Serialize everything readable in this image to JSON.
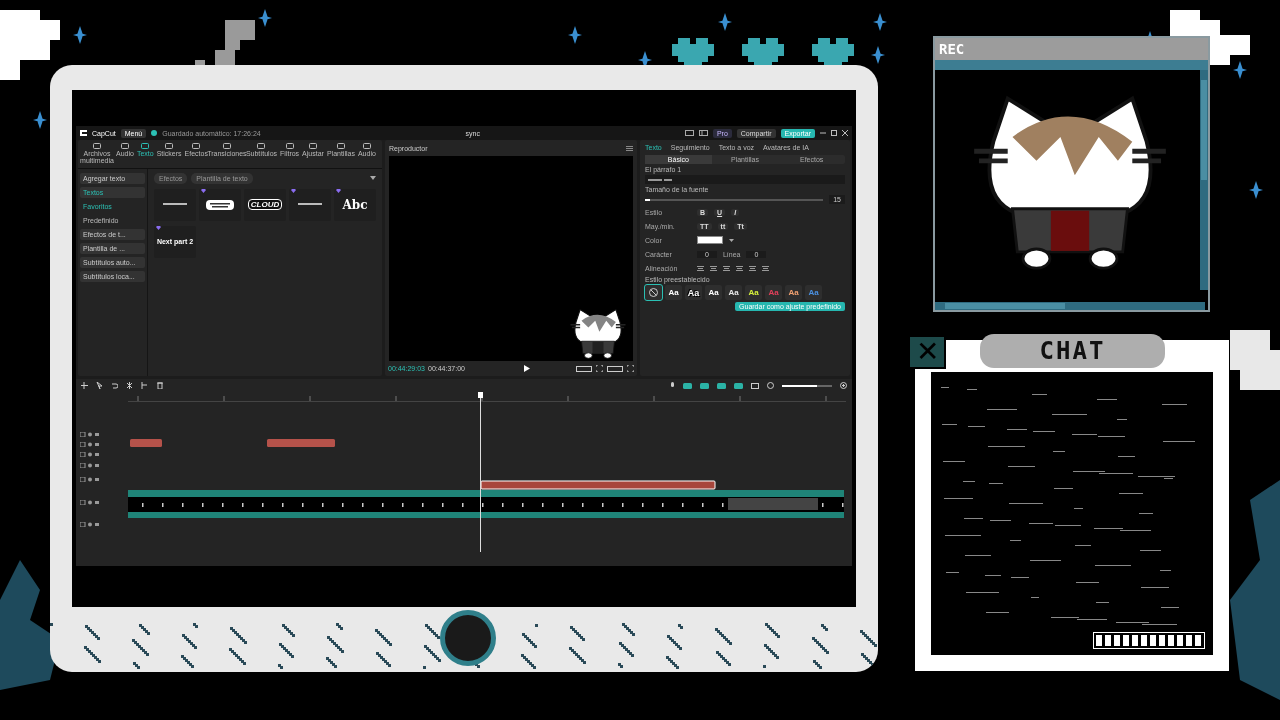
{
  "overlay": {
    "rec_window": {
      "title": "REC"
    },
    "chat": {
      "title": "CHAT",
      "close_label": "✕"
    }
  },
  "app": {
    "app_name": "CapCut",
    "menu": "Menú",
    "autosave": "Guardado automático: 17:26:24",
    "project_title": "sync",
    "header_buttons": [
      {
        "label": "Pro",
        "kind": "pro"
      },
      {
        "label": "Compartir",
        "kind": "share"
      },
      {
        "label": "Exportar",
        "kind": "export"
      }
    ],
    "toolbar": [
      {
        "label": "Archivos multimedia",
        "selected": false
      },
      {
        "label": "Audio",
        "selected": false
      },
      {
        "label": "Texto",
        "selected": true
      },
      {
        "label": "Stickers",
        "selected": false
      },
      {
        "label": "Efectos",
        "selected": false
      },
      {
        "label": "Transiciones",
        "selected": false
      },
      {
        "label": "Subtítulos",
        "selected": false
      },
      {
        "label": "Filtros",
        "selected": false
      },
      {
        "label": "Ajustar",
        "selected": false
      },
      {
        "label": "Plantillas",
        "selected": false
      },
      {
        "label": "Audio",
        "selected": false
      }
    ],
    "sidebar": [
      {
        "label": "Agregar texto",
        "kind": "group",
        "selected": false
      },
      {
        "label": "Textos",
        "kind": "group",
        "selected": true
      },
      {
        "label": "Favoritos",
        "kind": "item",
        "selected": true
      },
      {
        "label": "Predefinido",
        "kind": "item",
        "selected": false
      },
      {
        "label": "Efectos de t...",
        "kind": "group",
        "selected": false
      },
      {
        "label": "Plantilla de ...",
        "kind": "group",
        "selected": false
      },
      {
        "label": "Subtítulos auto...",
        "kind": "group",
        "selected": false
      },
      {
        "label": "Subtítulos loca...",
        "kind": "group",
        "selected": false
      }
    ],
    "filter_chips": [
      "Efectos",
      "Plantilla de texto"
    ],
    "text_cards": [
      {
        "kind": "plain",
        "premium": false
      },
      {
        "kind": "bubble",
        "premium": true
      },
      {
        "kind": "cloud",
        "text": "CLOUD",
        "premium": false
      },
      {
        "kind": "plain",
        "premium": true
      },
      {
        "kind": "serif",
        "text": "Abc",
        "premium": true
      },
      {
        "kind": "plain",
        "text": "Next part 2",
        "premium": true
      }
    ],
    "player": {
      "title": "Reproductor",
      "current_time": "00:44:29:03",
      "total_time": "00:44:37:00"
    },
    "inspector": {
      "tabs": [
        {
          "label": "Texto",
          "selected": true
        },
        {
          "label": "Seguimiento",
          "selected": false
        },
        {
          "label": "Texto a voz",
          "selected": false
        },
        {
          "label": "Avatares de IA",
          "selected": false
        }
      ],
      "subtabs": [
        {
          "label": "Básico",
          "selected": true
        },
        {
          "label": "Plantillas",
          "selected": false
        },
        {
          "label": "Efectos",
          "selected": false
        }
      ],
      "paragraph_label": "El párrafo 1",
      "font_size_label": "Tamaño de la fuente",
      "font_size": {
        "value": "15",
        "level": 0.03
      },
      "style_label": "Estilo",
      "style_buttons": [
        "B",
        "U",
        "I"
      ],
      "case_label": "May./min.",
      "case_buttons": [
        "TT",
        "tt",
        "Tt"
      ],
      "color_label": "Color",
      "color": "#ffffff",
      "char_label": "Carácter",
      "char_value": "0",
      "line_label": "Línea",
      "line_value": "0",
      "align_label": "Alineación",
      "preset_label": "Estilo preestablecido",
      "presets": [
        {
          "kind": "none",
          "selected": true
        },
        {
          "kind": "sample",
          "label": "Aa",
          "color": "#ffffff",
          "selected": false
        },
        {
          "kind": "outline",
          "label": "Aa",
          "color": "#ffffff",
          "selected": false
        },
        {
          "kind": "sample",
          "label": "Aa",
          "color": "#ffffff",
          "selected": false
        },
        {
          "kind": "sample",
          "label": "Aa",
          "color": "#e8e8e8",
          "selected": false
        },
        {
          "kind": "sample",
          "label": "Aa",
          "color": "#d6f03c",
          "selected": false
        },
        {
          "kind": "sample",
          "label": "Aa",
          "color": "#e0405a",
          "selected": false
        },
        {
          "kind": "sample",
          "label": "Aa",
          "color": "#f0a070",
          "selected": false
        },
        {
          "kind": "sample",
          "label": "Aa",
          "color": "#4a90e0",
          "selected": false
        }
      ],
      "save_button": "Guardar como ajuste predefinido"
    },
    "timeline": {
      "zoom": {
        "level": 0.7
      }
    }
  }
}
